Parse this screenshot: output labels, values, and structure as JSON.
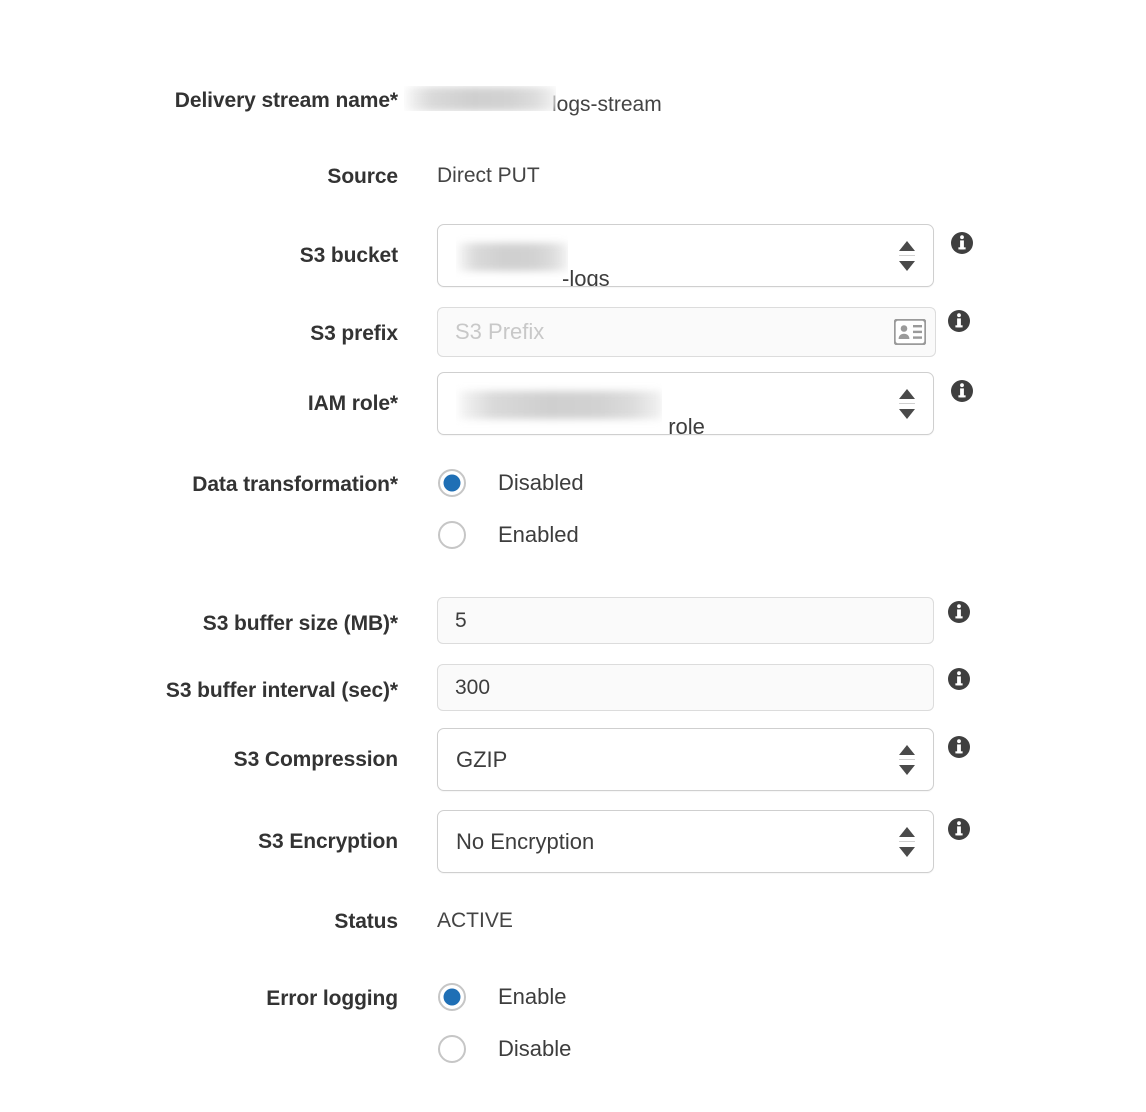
{
  "form": {
    "rows": [
      {
        "label": "Delivery stream name*",
        "type": "static-redacted",
        "redacted_prefix": true,
        "value": "logs-stream"
      },
      {
        "label": "Source",
        "type": "static",
        "value": "Direct PUT"
      },
      {
        "label": "S3 bucket",
        "type": "select",
        "redacted_prefix": true,
        "value": "-logs",
        "info": true
      },
      {
        "label": "S3 prefix",
        "type": "prefix-input",
        "value": "",
        "placeholder": "S3 Prefix",
        "icon": "contact-card-icon",
        "info": true
      },
      {
        "label": "IAM role*",
        "type": "select",
        "redacted_prefix": true,
        "value": "_role",
        "info": true
      },
      {
        "label": "Data transformation*",
        "type": "radio-group",
        "options": [
          {
            "label": "Disabled",
            "selected": true
          },
          {
            "label": "Enabled",
            "selected": false
          }
        ]
      },
      {
        "label": "S3 buffer size (MB)*",
        "type": "text-input",
        "value": "5",
        "info": true
      },
      {
        "label": "S3 buffer interval (sec)*",
        "type": "text-input",
        "value": "300",
        "info": true
      },
      {
        "label": "S3 Compression",
        "type": "select",
        "value": "GZIP",
        "info": true
      },
      {
        "label": "S3 Encryption",
        "type": "select",
        "value": "No Encryption",
        "info": true
      },
      {
        "label": "Status",
        "type": "static",
        "value": "ACTIVE"
      },
      {
        "label": "Error logging",
        "type": "radio-group",
        "options": [
          {
            "label": "Enable",
            "selected": true
          },
          {
            "label": "Disable",
            "selected": false
          }
        ]
      }
    ]
  },
  "colors": {
    "accent_radio": "#1f6fb5",
    "label_text": "#333333",
    "value_text": "#3d3d3d",
    "placeholder_text": "#c8c8c8",
    "info_icon": "#3f3f3f",
    "field_border": "#cfcfcf",
    "page_background": "#ffffff"
  },
  "icons": {
    "info": "info-icon",
    "stepper": "stepper-updown-icon",
    "contact_card": "contact-card-icon"
  }
}
